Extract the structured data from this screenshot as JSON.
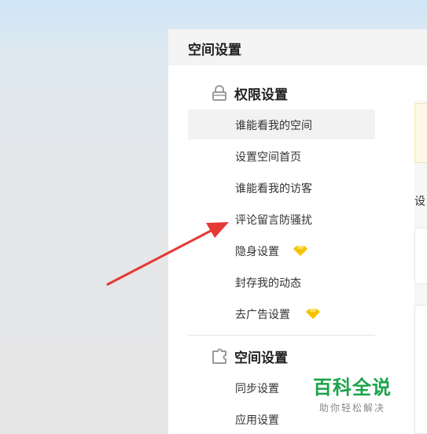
{
  "panel": {
    "title": "空间设置"
  },
  "sections": [
    {
      "title": "权限设置",
      "icon": "lock-icon",
      "items": [
        {
          "label": "谁能看我的空间",
          "active": true
        },
        {
          "label": "设置空间首页"
        },
        {
          "label": "谁能看我的访客"
        },
        {
          "label": "评论留言防骚扰"
        },
        {
          "label": "隐身设置",
          "badge": "vip-diamond-icon"
        },
        {
          "label": "封存我的动态"
        },
        {
          "label": "去广告设置",
          "badge": "vip-diamond-icon"
        }
      ]
    },
    {
      "title": "空间设置",
      "icon": "puzzle-icon",
      "items": [
        {
          "label": "同步设置"
        },
        {
          "label": "应用设置"
        }
      ]
    }
  ],
  "right": {
    "text": "设"
  },
  "watermark": {
    "main": "百科全说",
    "sub": "助你轻松解决"
  },
  "colors": {
    "arrow": "#e53935",
    "diamond": "#f5c400",
    "watermark": "#1aa34a"
  }
}
